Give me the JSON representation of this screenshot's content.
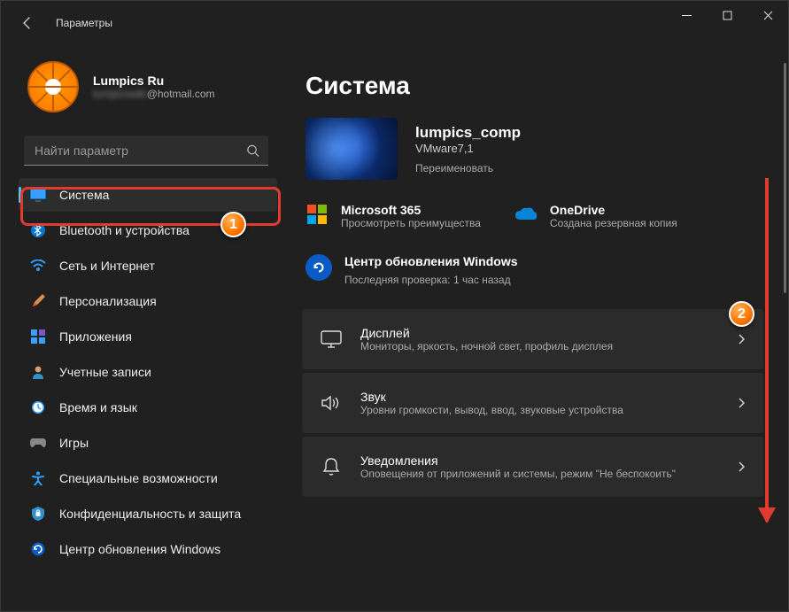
{
  "window": {
    "title": "Параметры"
  },
  "user": {
    "name": "Lumpics Ru",
    "email_hidden": "lumpicswiki",
    "email_domain": "@hotmail.com"
  },
  "search": {
    "placeholder": "Найти параметр"
  },
  "nav": {
    "items": [
      {
        "key": "system",
        "label": "Система",
        "selected": true
      },
      {
        "key": "bluetooth",
        "label": "Bluetooth и устройства"
      },
      {
        "key": "network",
        "label": "Сеть и Интернет"
      },
      {
        "key": "personalization",
        "label": "Персонализация"
      },
      {
        "key": "apps",
        "label": "Приложения"
      },
      {
        "key": "accounts",
        "label": "Учетные записи"
      },
      {
        "key": "time",
        "label": "Время и язык"
      },
      {
        "key": "gaming",
        "label": "Игры"
      },
      {
        "key": "accessibility",
        "label": "Специальные возможности"
      },
      {
        "key": "privacy",
        "label": "Конфиденциальность и защита"
      },
      {
        "key": "update",
        "label": "Центр обновления Windows"
      }
    ]
  },
  "page": {
    "heading": "Система",
    "pc": {
      "name": "lumpics_comp",
      "model": "VMware7,1",
      "rename": "Переименовать"
    },
    "promos": {
      "ms365": {
        "title": "Microsoft 365",
        "sub": "Просмотреть преимущества"
      },
      "onedrive": {
        "title": "OneDrive",
        "sub": "Создана резервная копия"
      }
    },
    "wu": {
      "title": "Центр обновления Windows",
      "sub": "Последняя проверка: 1 час назад"
    },
    "cards": [
      {
        "key": "display",
        "title": "Дисплей",
        "sub": "Мониторы, яркость, ночной свет, профиль дисплея"
      },
      {
        "key": "sound",
        "title": "Звук",
        "sub": "Уровни громкости, вывод, ввод, звуковые устройства"
      },
      {
        "key": "notifications",
        "title": "Уведомления",
        "sub": "Оповещения от приложений и системы, режим \"Не беспокоить\""
      }
    ]
  },
  "annotations": {
    "callout1": "1",
    "callout2": "2"
  }
}
